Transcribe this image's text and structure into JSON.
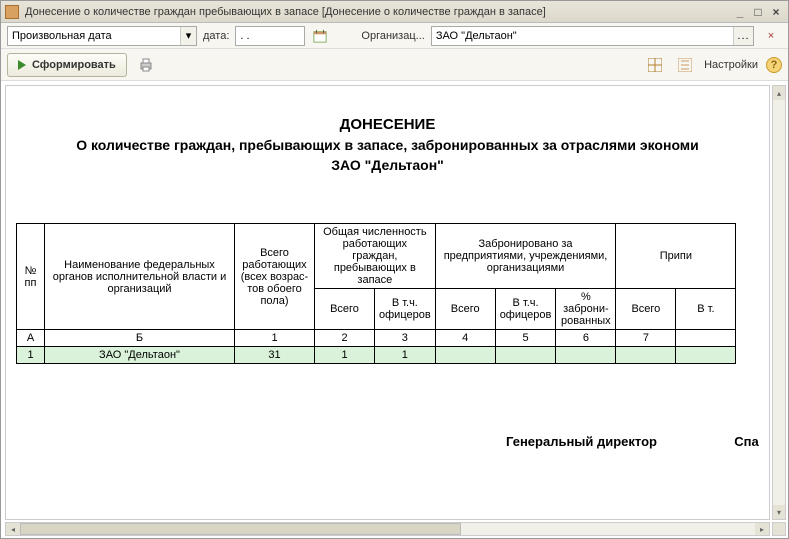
{
  "window": {
    "title": "Донесение о количестве граждан пребывающих в запасе [Донесение о количестве граждан в запасе]"
  },
  "toolbar1": {
    "period_mode": "Произвольная дата",
    "date_label": "дата:",
    "date_value": ". .",
    "org_label": "Организац...",
    "org_value": "ЗАО \"Дельтаон\"",
    "org_dots": "..."
  },
  "toolbar2": {
    "form_button": "Сформировать",
    "settings_label": "Настройки"
  },
  "report": {
    "title": "ДОНЕСЕНИЕ",
    "subtitle": "О количестве граждан, пребывающих в запасе, забронированных за отраслями экономи",
    "org_line": "ЗАО \"Дельтаон\"",
    "headers": {
      "col_num": "№ пп",
      "col_name": "Наименование федеральных органов исполнительной власти и организаций",
      "col_total_workers": "Всего работающих (всех возрас- тов обоего пола)",
      "group_reserve": "Общая численность работающих граждан, пребывающих в запасе",
      "group_booked": "Забронировано за предприятиями, учреждениями, организациями",
      "group_attached": "Припи",
      "sub_total": "Всего",
      "sub_officers": "В т.ч. офицеров",
      "sub_percent": "% заброни- рованных",
      "letter_a": "А",
      "letter_b": "Б",
      "n1": "1",
      "n2": "2",
      "n3": "3",
      "n4": "4",
      "n5": "5",
      "n6": "6",
      "n7": "7",
      "n8": "В т."
    },
    "rows": [
      {
        "num": "1",
        "name": "ЗАО \"Дельтаон\"",
        "c1": "31",
        "c2": "1",
        "c3": "1",
        "c4": "",
        "c5": "",
        "c6": "",
        "c7": "",
        "c8": ""
      }
    ],
    "signature_title": "Генеральный директор",
    "signature_name": "Спа"
  }
}
